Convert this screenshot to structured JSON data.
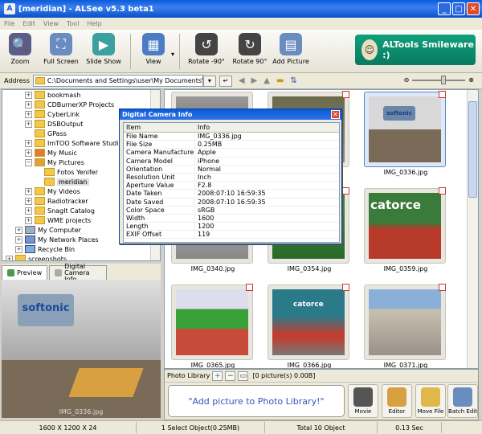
{
  "window": {
    "title": "[meridian] - ALSee v5.3 beta1"
  },
  "menu": [
    "File",
    "Edit",
    "View",
    "Tool",
    "Help"
  ],
  "toolbar": {
    "zoom": "Zoom",
    "fullscreen": "Full Screen",
    "slideshow": "Slide Show",
    "view": "View",
    "rotate_left": "Rotate -90°",
    "rotate_right": "Rotate 90°",
    "add_picture": "Add Picture",
    "banner": "ALTools Smileware :)"
  },
  "address": {
    "label": "Address",
    "path": "C:\\Documents and Settings\\user\\My Documents\\M"
  },
  "tree": [
    "bookmash",
    "CDBurnerXP Projects",
    "CyberLink",
    "DSBOutput",
    "GPass",
    "ImTOO Software Studio",
    "My Music",
    "My Pictures",
    "Fotos Yenifer",
    "meridian",
    "My Videos",
    "Radiotracker",
    "SnagIt Catalog",
    "WME projects",
    "My Computer",
    "My Network Places",
    "Recycle Bin",
    "screenshots"
  ],
  "tabs": {
    "preview": "Preview",
    "camera": "Digital Camera Info"
  },
  "preview": {
    "brand": "softonic",
    "caption": "IMG_0336.jpg"
  },
  "thumbnails": [
    {
      "name": ""
    },
    {
      "name": ""
    },
    {
      "name": "IMG_0336.jpg"
    },
    {
      "name": "IMG_0340.jpg"
    },
    {
      "name": "IMG_0354.jpg"
    },
    {
      "name": "IMG_0359.jpg"
    },
    {
      "name": "IMG_0365.jpg"
    },
    {
      "name": "IMG_0366.jpg"
    },
    {
      "name": "IMG_0371.jpg"
    }
  ],
  "dialog": {
    "title": "Digital Camera Info",
    "col_item": "Item",
    "col_info": "Info",
    "rows": [
      [
        "File Name",
        "IMG_0336.jpg"
      ],
      [
        "File Size",
        "0.25MB"
      ],
      [
        "Camera Manufacturer",
        "Apple"
      ],
      [
        "Camera Model",
        "iPhone"
      ],
      [
        "Orientation",
        "Normal"
      ],
      [
        "Resolution Unit",
        "Inch"
      ],
      [
        "Aperture Value",
        "F2.8"
      ],
      [
        "Date Taken",
        "2008:07:10 16:59:35"
      ],
      [
        "Date Saved",
        "2008:07:10 16:59:35"
      ],
      [
        "Color Space",
        "sRGB"
      ],
      [
        "Width",
        "1600"
      ],
      [
        "Length",
        "1200"
      ],
      [
        "EXIF Offset",
        "119"
      ]
    ]
  },
  "photo_library": {
    "label": "Photo Library",
    "count": "[0 picture(s) 0.00B]",
    "add_hint": "\"Add picture to Photo Library!\"",
    "movie": "Movie",
    "editor": "Editor",
    "move_file": "Move File",
    "batch_edit": "Batch Edit"
  },
  "status": {
    "dims": "1600 X 1200 X 24",
    "selection": "1 Select Object(0.25MB)",
    "total": "Total 10 Object",
    "time": "0.13 Sec"
  }
}
